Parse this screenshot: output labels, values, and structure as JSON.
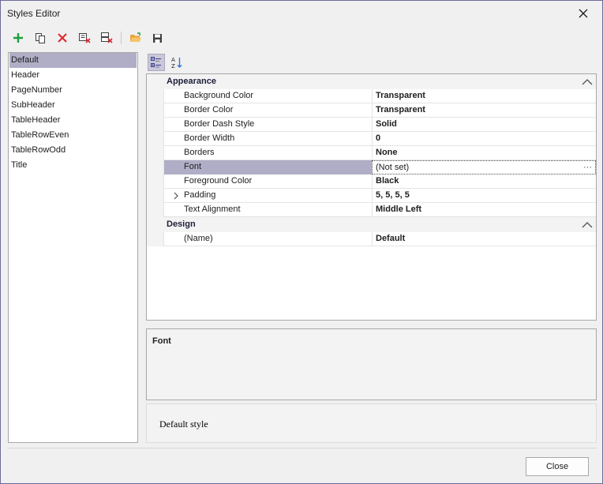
{
  "window": {
    "title": "Styles Editor"
  },
  "icons": {
    "add": "plus-icon",
    "duplicate": "copy-icon",
    "remove": "delete-icon",
    "purge": "clear-styles-icon",
    "purge_all": "clear-all-styles-icon",
    "load": "open-folder-icon",
    "save": "save-icon",
    "categorized": "categorized-view-icon",
    "alphabetical": "sort-az-icon"
  },
  "colors": {
    "accent_selected": "#b0aec6",
    "add_green": "#1e9e3a",
    "delete_red": "#e0262b",
    "folder_orange": "#e9a23b"
  },
  "styles": {
    "items": [
      {
        "label": "Default",
        "selected": true
      },
      {
        "label": "Header",
        "selected": false
      },
      {
        "label": "PageNumber",
        "selected": false
      },
      {
        "label": "SubHeader",
        "selected": false
      },
      {
        "label": "TableHeader",
        "selected": false
      },
      {
        "label": "TableRowEven",
        "selected": false
      },
      {
        "label": "TableRowOdd",
        "selected": false
      },
      {
        "label": "Title",
        "selected": false
      }
    ]
  },
  "grid": {
    "categories": [
      {
        "label": "Appearance",
        "properties": [
          {
            "name": "Background Color",
            "value": "Transparent"
          },
          {
            "name": "Border Color",
            "value": "Transparent"
          },
          {
            "name": "Border Dash Style",
            "value": "Solid"
          },
          {
            "name": "Border Width",
            "value": "0"
          },
          {
            "name": "Borders",
            "value": "None"
          },
          {
            "name": "Font",
            "value": "(Not set)",
            "ellipsis": "···"
          },
          {
            "name": "Foreground Color",
            "value": "Black"
          },
          {
            "name": "Padding",
            "value": "5, 5, 5, 5"
          },
          {
            "name": "Text Alignment",
            "value": "Middle Left"
          }
        ]
      },
      {
        "label": "Design",
        "properties": [
          {
            "name": "(Name)",
            "value": "Default"
          }
        ]
      }
    ]
  },
  "description": {
    "title": "Font"
  },
  "preview": {
    "text": "Default style"
  },
  "footer": {
    "close_label": "Close"
  }
}
